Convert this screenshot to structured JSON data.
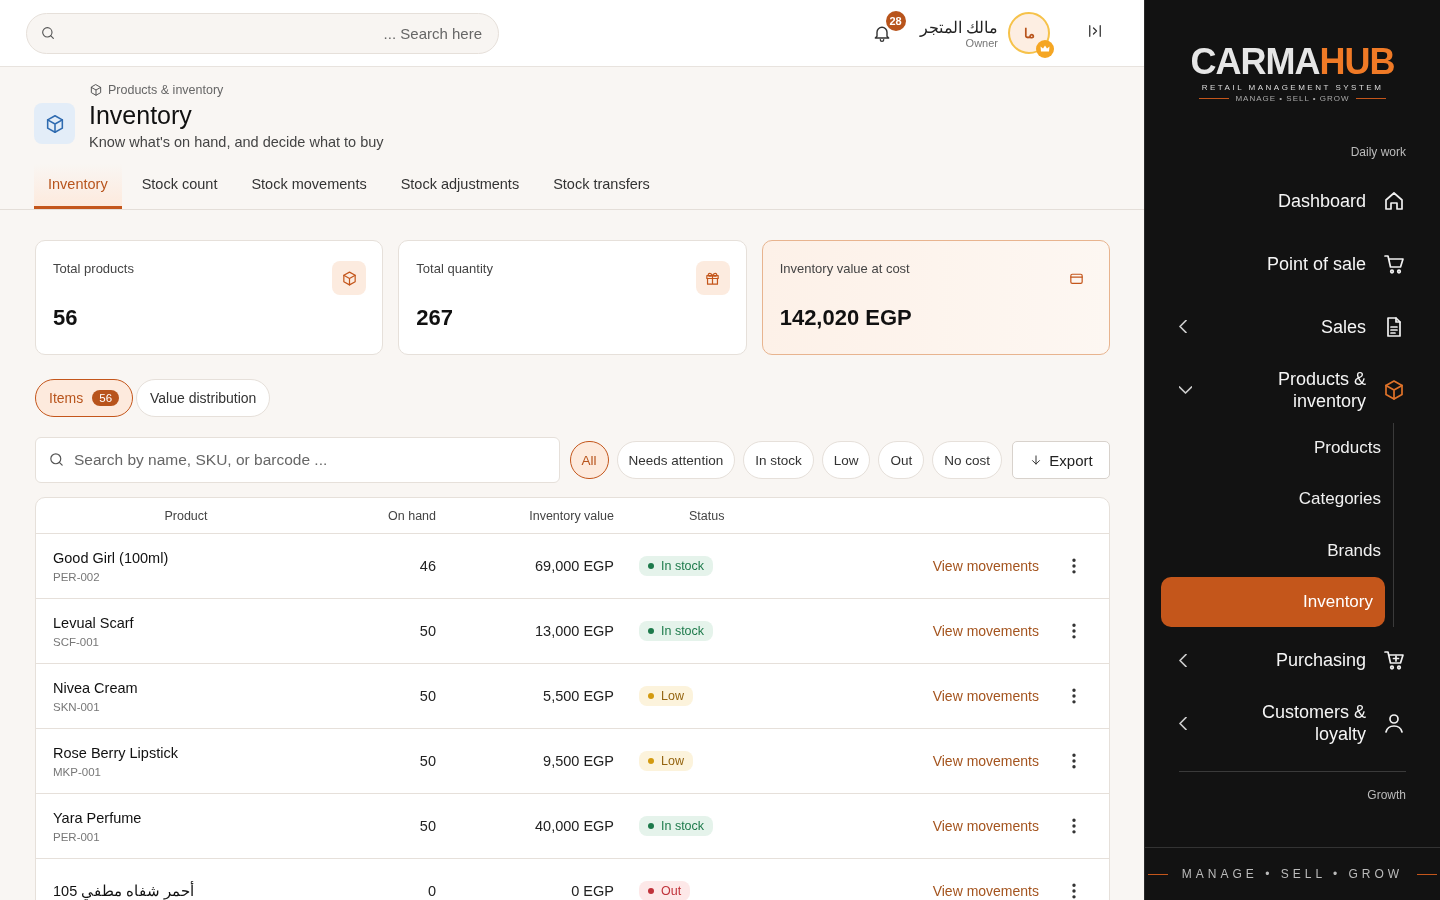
{
  "topbar": {
    "search": {
      "placeholder": "... Search here"
    },
    "notifications": {
      "count": "28"
    },
    "user": {
      "name": "مالك المتجر",
      "role": "Owner",
      "initials": "ما"
    }
  },
  "breadcrumb": "Products & inventory",
  "page": {
    "title": "Inventory",
    "subtitle": "Know what's on hand, and decide what to buy"
  },
  "tabs": [
    {
      "label": "Inventory",
      "selected": true
    },
    {
      "label": "Stock count",
      "selected": false
    },
    {
      "label": "Stock movements",
      "selected": false
    },
    {
      "label": "Stock adjustments",
      "selected": false
    },
    {
      "label": "Stock transfers",
      "selected": false
    }
  ],
  "stats": [
    {
      "kind": "products",
      "label": "Total products",
      "value": "56",
      "highlighted": false
    },
    {
      "kind": "quantity",
      "label": "Total quantity",
      "value": "267",
      "highlighted": false
    },
    {
      "kind": "value",
      "label": "Inventory value at cost",
      "value": "142,020 EGP",
      "highlighted": true
    }
  ],
  "views": [
    {
      "label": "Items",
      "count": "56",
      "selected": true
    },
    {
      "label": "Value distribution",
      "selected": false
    }
  ],
  "item_search": {
    "placeholder": "Search by name, SKU, or barcode ..."
  },
  "filters": [
    {
      "label": "All",
      "selected": true
    },
    {
      "label": "Needs attention",
      "selected": false
    },
    {
      "label": "In stock",
      "selected": false
    },
    {
      "label": "Low",
      "selected": false
    },
    {
      "label": "Out",
      "selected": false
    },
    {
      "label": "No cost",
      "selected": false
    }
  ],
  "export_button": "Export",
  "table": {
    "columns": [
      "Product",
      "On hand",
      "Inventory value",
      "Status"
    ],
    "rows": [
      {
        "name": "Good Girl (100ml)",
        "sku": "PER-002",
        "on_hand": "46",
        "value": "69,000 EGP",
        "status": {
          "kind": "in_stock",
          "label": "In stock"
        },
        "action": "View movements"
      },
      {
        "name": "Levual Scarf",
        "sku": "SCF-001",
        "on_hand": "50",
        "value": "13,000 EGP",
        "status": {
          "kind": "in_stock",
          "label": "In stock"
        },
        "action": "View movements"
      },
      {
        "name": "Nivea Cream",
        "sku": "SKN-001",
        "on_hand": "50",
        "value": "5,500 EGP",
        "status": {
          "kind": "low",
          "label": "Low"
        },
        "action": "View movements"
      },
      {
        "name": "Rose Berry Lipstick",
        "sku": "MKP-001",
        "on_hand": "50",
        "value": "9,500 EGP",
        "status": {
          "kind": "low",
          "label": "Low"
        },
        "action": "View movements"
      },
      {
        "name": "Yara Perfume",
        "sku": "PER-001",
        "on_hand": "50",
        "value": "40,000 EGP",
        "status": {
          "kind": "in_stock",
          "label": "In stock"
        },
        "action": "View movements"
      },
      {
        "name": "أحمر شفاه مطفي 105",
        "on_hand": "0",
        "value": "0 EGP",
        "status": {
          "kind": "out",
          "label": "Out"
        },
        "action": "View movements"
      }
    ]
  },
  "sidebar": {
    "logo": {
      "brand_start": "CARMA",
      "brand_end": "HUB",
      "tagline": "RETAIL MANAGEMENT SYSTEM",
      "motto": "MANAGE • SELL • GROW"
    },
    "sections": [
      {
        "title": "Daily work",
        "items": [
          {
            "kind": "dashboard",
            "label": "Dashboard"
          },
          {
            "kind": "pos",
            "label": "Point of sale"
          },
          {
            "kind": "sales",
            "label": "Sales",
            "expanded": false
          },
          {
            "kind": "products",
            "label": "Products & inventory",
            "expanded": true,
            "children": [
              {
                "label": "Products",
                "selected": false
              },
              {
                "label": "Categories",
                "selected": false
              },
              {
                "label": "Brands",
                "selected": false
              },
              {
                "label": "Inventory",
                "selected": true
              }
            ]
          },
          {
            "kind": "purchasing",
            "label": "Purchasing",
            "expanded": false
          },
          {
            "kind": "customers",
            "label": "Customers & loyalty",
            "expanded": false
          }
        ]
      },
      {
        "title": "Growth"
      }
    ],
    "footer": "MANAGE • SELL • GROW"
  }
}
